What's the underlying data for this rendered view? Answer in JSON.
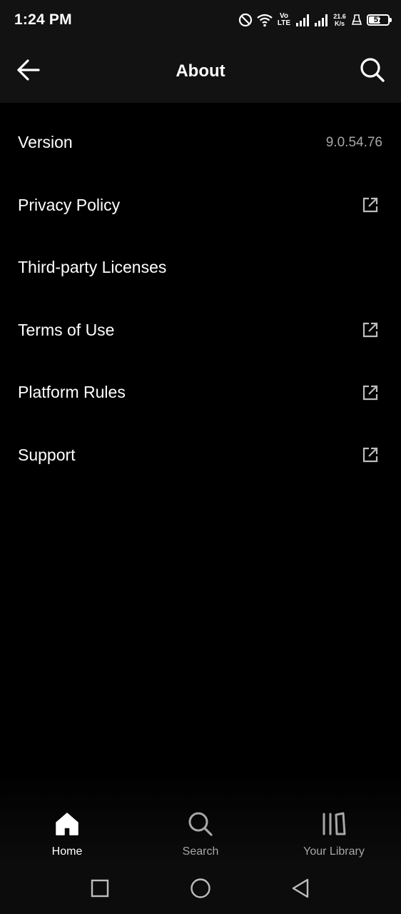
{
  "status_bar": {
    "time": "1:24 PM",
    "volte_top": "Vo",
    "volte_bottom": "LTE",
    "net_speed_value": "21.6",
    "net_speed_unit": "K/s",
    "battery_level": "57",
    "icons": [
      "do-not-disturb-icon",
      "wifi-icon",
      "volte-icon",
      "signal-icon",
      "signal-icon",
      "net-speed-icon",
      "vibrate-icon",
      "battery-icon"
    ]
  },
  "header": {
    "title": "About",
    "back_icon": "arrow-left-icon",
    "search_icon": "search-icon"
  },
  "settings": {
    "items": [
      {
        "label": "Version",
        "value": "9.0.54.76"
      },
      {
        "label": "Privacy Policy",
        "icon": "external-link-icon"
      },
      {
        "label": "Third-party Licenses"
      },
      {
        "label": "Terms of Use",
        "icon": "external-link-icon"
      },
      {
        "label": "Platform Rules",
        "icon": "external-link-icon"
      },
      {
        "label": "Support",
        "icon": "external-link-icon"
      }
    ]
  },
  "bottom_nav": {
    "items": [
      {
        "label": "Home",
        "icon": "home-icon",
        "active": true
      },
      {
        "label": "Search",
        "icon": "search-icon",
        "active": false
      },
      {
        "label": "Your Library",
        "icon": "library-icon",
        "active": false
      }
    ]
  },
  "system_nav": {
    "icons": [
      "recents-square-icon",
      "home-circle-icon",
      "back-triangle-icon"
    ]
  },
  "colors": {
    "background": "#000000",
    "header_background": "#121212",
    "primary_text": "#ffffff",
    "secondary_text": "#a7a7a7"
  }
}
